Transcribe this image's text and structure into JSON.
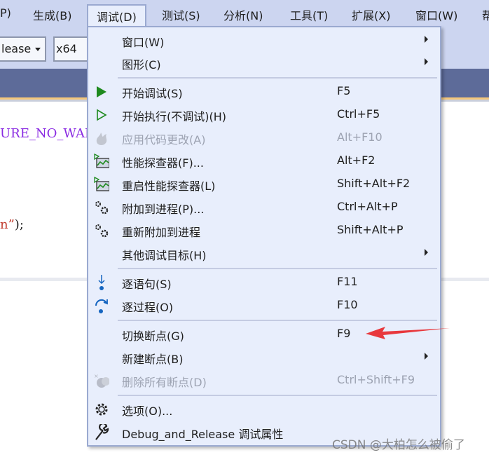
{
  "menubar": {
    "items": [
      "P)",
      "生成(B)",
      "调试(D)",
      "测试(S)",
      "分析(N)",
      "工具(T)",
      "扩展(X)",
      "窗口(W)",
      "帮"
    ]
  },
  "toolbar": {
    "config": "lease",
    "platform": "x64"
  },
  "code": {
    "line1": "URE_NO_WAR",
    "line2_str": "n”",
    "line2_rest": ");"
  },
  "menu": {
    "items": [
      {
        "label": "窗口(W)",
        "submenu": true
      },
      {
        "label": "图形(C)",
        "submenu": true
      },
      {
        "label": "开始调试(S)",
        "shortcut": "F5",
        "icon": "play-filled-icon"
      },
      {
        "label": "开始执行(不调试)(H)",
        "shortcut": "Ctrl+F5",
        "icon": "play-outline-icon"
      },
      {
        "label": "应用代码更改(A)",
        "shortcut": "Alt+F10",
        "icon": "flame-icon",
        "disabled": true
      },
      {
        "label": "性能探查器(F)...",
        "shortcut": "Alt+F2",
        "icon": "performance-profiler-icon"
      },
      {
        "label": "重启性能探查器(L)",
        "shortcut": "Shift+Alt+F2",
        "icon": "performance-profiler-icon"
      },
      {
        "label": "附加到进程(P)...",
        "shortcut": "Ctrl+Alt+P",
        "icon": "gears-icon"
      },
      {
        "label": "重新附加到进程",
        "shortcut": "Shift+Alt+P",
        "icon": "gears-icon"
      },
      {
        "label": "其他调试目标(H)",
        "submenu": true
      },
      {
        "label": "逐语句(S)",
        "shortcut": "F11",
        "icon": "step-into-icon"
      },
      {
        "label": "逐过程(O)",
        "shortcut": "F10",
        "icon": "step-over-icon"
      },
      {
        "label": "切换断点(G)",
        "shortcut": "F9"
      },
      {
        "label": "新建断点(B)",
        "submenu": true
      },
      {
        "label": "删除所有断点(D)",
        "shortcut": "Ctrl+Shift+F9",
        "icon": "delete-breakpoints-icon",
        "disabled": true
      },
      {
        "label": "选项(O)...",
        "icon": "gear-icon"
      },
      {
        "label": "Debug_and_Release 调试属性",
        "icon": "wrench-icon"
      }
    ]
  },
  "watermark": "CSDN @大柏怎么被偷了",
  "colors": {
    "menubar": "#ccd5f0",
    "menu": "#e8eefc",
    "band": "#5d6b99",
    "annotation_arrow": "#e8383d",
    "play": "#1e8a1e"
  }
}
